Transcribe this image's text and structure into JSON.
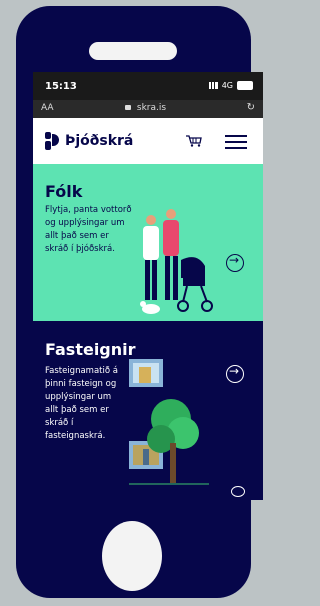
{
  "status_bar": {
    "time": "15:13",
    "network": "4G"
  },
  "browser": {
    "text_size": "AA",
    "url": "skra.is"
  },
  "site": {
    "logo": "Þjóðskrá"
  },
  "cards": [
    {
      "title": "Fólk",
      "description": "Flytja, panta vottorð og upplýsingar um allt það sem er skráð í þjóðskrá."
    },
    {
      "title": "Fasteignir",
      "description": "Fasteignamatið á þinni fasteign og upplýsingar um allt það sem er skráð í fasteignaskrá."
    }
  ],
  "colors": {
    "navy": "#06064a",
    "mint": "#5de3b2"
  }
}
